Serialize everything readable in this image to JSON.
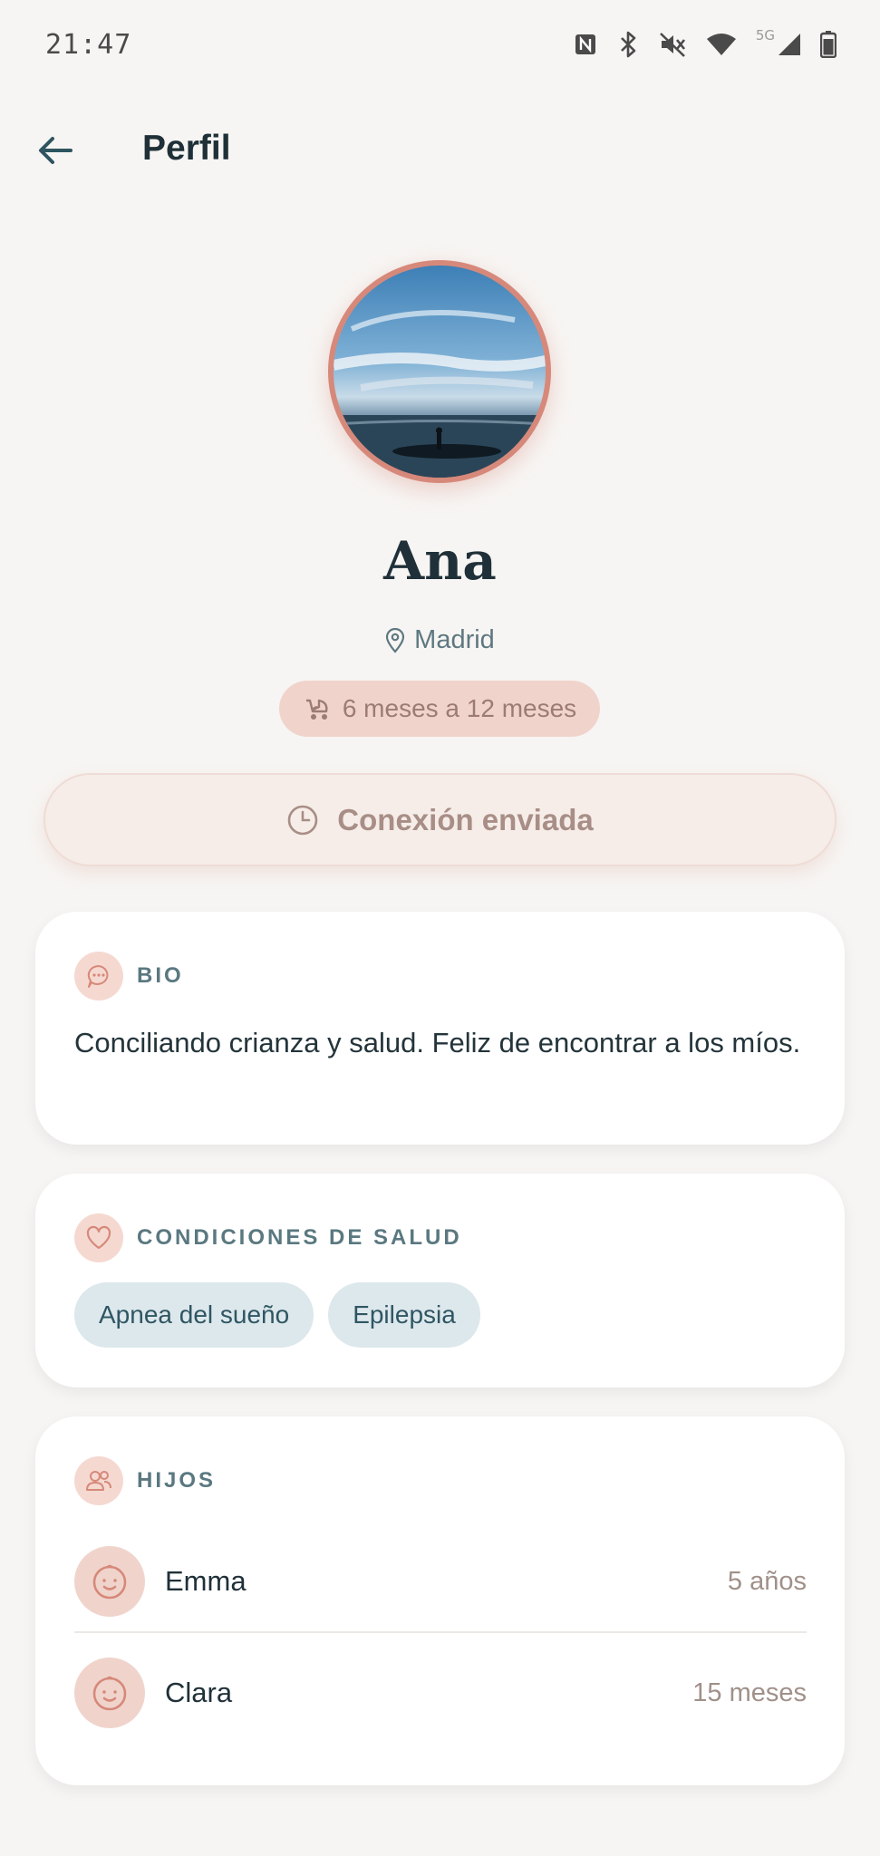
{
  "status_bar": {
    "time": "21:47",
    "network": "5G",
    "icons": [
      "nfc-icon",
      "bluetooth-icon",
      "mute-icon",
      "wifi-icon",
      "signal-icon",
      "battery-icon"
    ]
  },
  "header": {
    "back_icon": "arrow-left-icon",
    "title": "Perfil"
  },
  "profile": {
    "name": "Ana",
    "location": "Madrid",
    "location_icon": "map-pin-icon",
    "age_range": "6 meses a 12 meses",
    "age_range_icon": "stroller-icon",
    "avatar_image": "sea-sky-photo"
  },
  "connection_button": {
    "label": "Conexión enviada",
    "icon": "clock-icon"
  },
  "bio": {
    "label": "BIO",
    "icon": "chat-bubble-icon",
    "text": "Conciliando crianza y salud. Feliz de encontrar a los míos."
  },
  "health": {
    "label": "CONDICIONES DE SALUD",
    "icon": "heart-icon",
    "tags": [
      "Apnea del sueño",
      "Epilepsia"
    ]
  },
  "children": {
    "label": "HIJOS",
    "icon": "people-icon",
    "items": [
      {
        "name": "Emma",
        "age": "5 años",
        "icon": "baby-face-icon"
      },
      {
        "name": "Clara",
        "age": "15 meses",
        "icon": "baby-face-icon"
      }
    ]
  },
  "colors": {
    "background": "#f7f5f3",
    "accent_rose": "#d6897a",
    "pill_rose": "#f0d4cc",
    "tag_blue": "#dde8ec",
    "text_dark": "#1f3038",
    "text_muted": "#5a7880"
  }
}
